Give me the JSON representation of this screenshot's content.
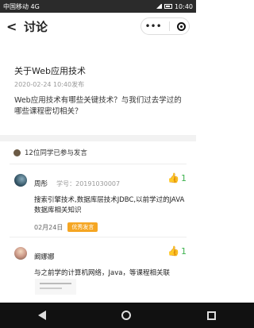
{
  "status_bar": {
    "carrier": "中国移动 4G",
    "time": "10:40"
  },
  "header": {
    "back": "<",
    "title": "讨论",
    "menu": "•••"
  },
  "topic": {
    "title": "关于Web应用技术",
    "meta": "2020-02-24 10:40发布",
    "body": "Web应用技术有哪些关键技术？与我们过去学过的哪些课程密切相关？"
  },
  "participants": {
    "text": "12位同学已参与发言"
  },
  "replies": [
    {
      "name": "周彤",
      "student_no": "学号：20191030007",
      "text": "搜索引擎技术,数据库层技术JDBC,以前学过的JAVA数据库相关知识",
      "date": "02月24日",
      "badge": "优秀发言",
      "likes": "1"
    },
    {
      "name": "阚娜娜",
      "text": "与之前学的计算机网络，Java，等课程相关联",
      "likes": "1"
    }
  ]
}
